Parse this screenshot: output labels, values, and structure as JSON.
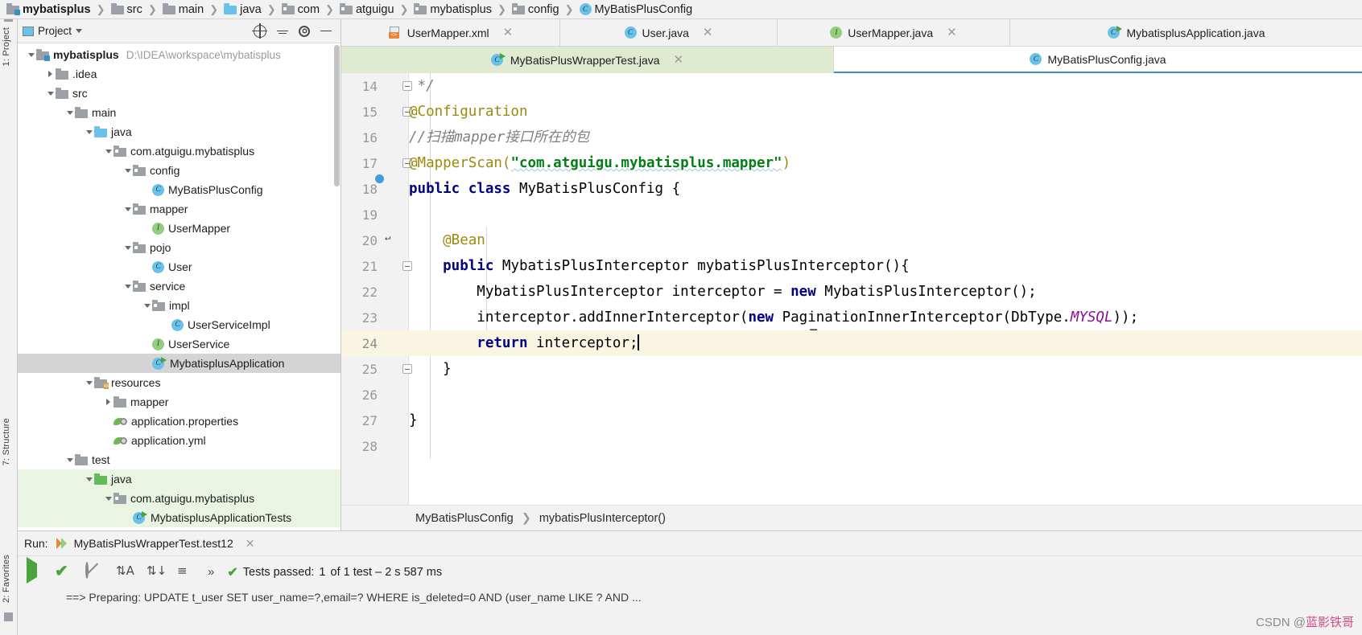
{
  "window": {
    "breadcrumb": [
      {
        "label": "mybatisplus",
        "icon": "module-folder-icon",
        "bold": true
      },
      {
        "label": "src",
        "icon": "folder-icon"
      },
      {
        "label": "main",
        "icon": "folder-icon"
      },
      {
        "label": "java",
        "icon": "source-folder-icon"
      },
      {
        "label": "com",
        "icon": "package-icon"
      },
      {
        "label": "atguigu",
        "icon": "package-icon"
      },
      {
        "label": "mybatisplus",
        "icon": "package-icon"
      },
      {
        "label": "config",
        "icon": "package-icon"
      },
      {
        "label": "MyBatisPlusConfig",
        "icon": "java-class-icon"
      }
    ]
  },
  "rail": {
    "top_label": "1: Project",
    "mid_label": "7: Structure",
    "bottom_label": "2: Favorites"
  },
  "project_panel": {
    "title": "Project",
    "actions": [
      "locate-icon",
      "collapse-all-icon",
      "settings-icon",
      "hide-icon"
    ],
    "tree": [
      {
        "label": "mybatisplus",
        "path": "D:\\IDEA\\workspace\\mybatisplus",
        "icon": "module-folder-icon",
        "depth": 0,
        "twisty": "expanded",
        "bold": true
      },
      {
        "label": ".idea",
        "icon": "folder-icon",
        "depth": 1,
        "twisty": "collapsed"
      },
      {
        "label": "src",
        "icon": "folder-icon",
        "depth": 1,
        "twisty": "expanded"
      },
      {
        "label": "main",
        "icon": "folder-icon",
        "depth": 2,
        "twisty": "expanded"
      },
      {
        "label": "java",
        "icon": "source-folder-icon",
        "depth": 3,
        "twisty": "expanded"
      },
      {
        "label": "com.atguigu.mybatisplus",
        "icon": "package-icon",
        "depth": 4,
        "twisty": "expanded"
      },
      {
        "label": "config",
        "icon": "package-icon",
        "depth": 5,
        "twisty": "expanded"
      },
      {
        "label": "MyBatisPlusConfig",
        "icon": "java-class-icon",
        "depth": 6,
        "twisty": "none"
      },
      {
        "label": "mapper",
        "icon": "package-icon",
        "depth": 5,
        "twisty": "expanded"
      },
      {
        "label": "UserMapper",
        "icon": "java-interface-icon",
        "depth": 6,
        "twisty": "none"
      },
      {
        "label": "pojo",
        "icon": "package-icon",
        "depth": 5,
        "twisty": "expanded"
      },
      {
        "label": "User",
        "icon": "java-class-icon",
        "depth": 6,
        "twisty": "none"
      },
      {
        "label": "service",
        "icon": "package-icon",
        "depth": 5,
        "twisty": "expanded"
      },
      {
        "label": "impl",
        "icon": "package-icon",
        "depth": 6,
        "twisty": "expanded"
      },
      {
        "label": "UserServiceImpl",
        "icon": "java-class-icon",
        "depth": 7,
        "twisty": "none"
      },
      {
        "label": "UserService",
        "icon": "java-interface-icon",
        "depth": 6,
        "twisty": "none"
      },
      {
        "label": "MybatisplusApplication",
        "icon": "runnable-class-icon",
        "depth": 6,
        "twisty": "none",
        "selected": true
      },
      {
        "label": "resources",
        "icon": "resources-folder-icon",
        "depth": 3,
        "twisty": "expanded"
      },
      {
        "label": "mapper",
        "icon": "folder-icon",
        "depth": 4,
        "twisty": "collapsed"
      },
      {
        "label": "application.properties",
        "icon": "spring-config-icon",
        "depth": 4,
        "twisty": "none"
      },
      {
        "label": "application.yml",
        "icon": "spring-config-icon",
        "depth": 4,
        "twisty": "none"
      },
      {
        "label": "test",
        "icon": "folder-icon",
        "depth": 2,
        "twisty": "expanded"
      },
      {
        "label": "java",
        "icon": "test-source-folder-icon",
        "depth": 3,
        "twisty": "expanded",
        "test_source": true
      },
      {
        "label": "com.atguigu.mybatisplus",
        "icon": "package-icon",
        "depth": 4,
        "twisty": "expanded",
        "test_source": true
      },
      {
        "label": "MybatisplusApplicationTests",
        "icon": "runnable-class-icon",
        "depth": 5,
        "twisty": "none",
        "test_source": true
      }
    ]
  },
  "editor_tabs": {
    "row1": [
      {
        "label": "UserMapper.xml",
        "icon": "xml-file-icon",
        "closable": true
      },
      {
        "label": "User.java",
        "icon": "java-class-icon",
        "closable": true
      },
      {
        "label": "UserMapper.java",
        "icon": "java-interface-icon",
        "closable": true
      },
      {
        "label": "MybatisplusApplication.java",
        "icon": "runnable-class-icon",
        "closable": false
      }
    ],
    "row2": [
      {
        "label": "MyBatisPlusWrapperTest.java",
        "icon": "runnable-class-icon",
        "closable": true,
        "test_tab": true
      },
      {
        "label": "MyBatisPlusConfig.java",
        "icon": "java-class-icon",
        "closable": false,
        "active": true
      }
    ]
  },
  "editor": {
    "lines": [
      {
        "num": "14",
        "fold": true,
        "marker": "",
        "segments": [
          {
            "t": " */",
            "c": "cmt"
          }
        ]
      },
      {
        "num": "15",
        "fold": true,
        "marker": "",
        "segments": [
          {
            "t": "@Configuration",
            "c": "ann"
          }
        ]
      },
      {
        "num": "16",
        "fold": false,
        "marker": "",
        "segments": [
          {
            "t": "//扫描mapper接口所在的包",
            "c": "cmt"
          }
        ]
      },
      {
        "num": "17",
        "fold": true,
        "marker": "",
        "segments": [
          {
            "t": "@MapperScan(",
            "c": "ann"
          },
          {
            "t": "\"com.atguigu.mybatisplus.mapper\"",
            "c": "str squig"
          },
          {
            "t": ")",
            "c": "ann"
          }
        ]
      },
      {
        "num": "18",
        "fold": false,
        "marker": "spring-bean-icon",
        "segments": [
          {
            "t": "public class ",
            "c": "kw"
          },
          {
            "t": "MyBatisPlusConfig {",
            "c": ""
          }
        ]
      },
      {
        "num": "19",
        "fold": false,
        "marker": "",
        "segments": []
      },
      {
        "num": "20",
        "fold": false,
        "marker": "bean-icon",
        "segments": [
          {
            "t": "    @Bean",
            "c": "ann"
          }
        ]
      },
      {
        "num": "21",
        "fold": true,
        "marker": "",
        "segments": [
          {
            "t": "    public ",
            "c": "kw"
          },
          {
            "t": "MybatisPlusInterceptor mybatisPlusInterceptor(){",
            "c": ""
          }
        ]
      },
      {
        "num": "22",
        "fold": false,
        "marker": "",
        "segments": [
          {
            "t": "        MybatisPlusInterceptor interceptor = ",
            "c": ""
          },
          {
            "t": "new ",
            "c": "kw"
          },
          {
            "t": "MybatisPlusInterceptor();",
            "c": ""
          }
        ]
      },
      {
        "num": "23",
        "fold": false,
        "marker": "",
        "segments": [
          {
            "t": "        interceptor.addInnerInterceptor(",
            "c": ""
          },
          {
            "t": "new ",
            "c": "kw"
          },
          {
            "t": "PaginationInnerInterceptor(DbType.",
            "c": ""
          },
          {
            "t": "MYSQL",
            "c": "field"
          },
          {
            "t": "));",
            "c": ""
          }
        ]
      },
      {
        "num": "24",
        "fold": false,
        "marker": "",
        "current": true,
        "caret": true,
        "segments": [
          {
            "t": "        return ",
            "c": "kw"
          },
          {
            "t": "interceptor;",
            "c": ""
          }
        ]
      },
      {
        "num": "25",
        "fold": true,
        "marker": "",
        "segments": [
          {
            "t": "    }",
            "c": ""
          }
        ]
      },
      {
        "num": "26",
        "fold": false,
        "marker": "",
        "segments": []
      },
      {
        "num": "27",
        "fold": false,
        "marker": "",
        "segments": [
          {
            "t": "}",
            "c": ""
          }
        ]
      },
      {
        "num": "28",
        "fold": false,
        "marker": "",
        "segments": []
      }
    ],
    "breadcrumb": [
      "MyBatisPlusConfig",
      "mybatisPlusInterceptor()"
    ]
  },
  "run_panel": {
    "label": "Run:",
    "config_name": "MyBatisPlusWrapperTest.test12",
    "toolbar_icons": [
      "rerun-icon",
      "toggle-passed-icon",
      "dismiss-icon",
      "sort-alpha-icon",
      "sort-duration-icon",
      "expand-icon",
      "more-icon"
    ],
    "status_prefix": "Tests passed: ",
    "status_count": "1",
    "status_suffix": " of 1 test – 2 s 587 ms",
    "console_line": "==>  Preparing: UPDATE t_user SET user_name=?,email=? WHERE is_deleted=0 AND (user_name LIKE ? AND ...",
    "watermark_text": "CSDN @",
    "watermark_author": "蓝影铁哥"
  },
  "colors": {
    "accent": "#3c8fd1",
    "test_green": "#e9f5e2",
    "current_line": "#faf5e3",
    "keyword": "#000080",
    "string": "#067d17",
    "annotation": "#9e880d",
    "comment": "#808080",
    "field": "#871094"
  }
}
